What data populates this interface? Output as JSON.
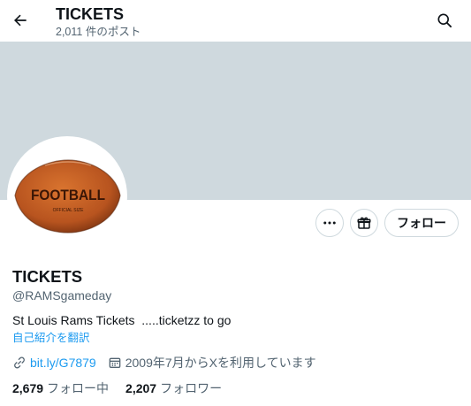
{
  "header": {
    "title": "TICKETS",
    "post_count": "2,011 件のポスト"
  },
  "avatar": {
    "text": "FOOTBALL",
    "subtext": "OFFICIAL SIZE"
  },
  "actions": {
    "follow_label": "フォロー"
  },
  "profile": {
    "name": "TICKETS",
    "handle": "@RAMSgameday",
    "bio": "St Louis Rams Tickets  .....ticketzz to go",
    "translate_label": "自己紹介を翻訳",
    "link": "bit.ly/G7879",
    "joined": "2009年7月からXを利用しています"
  },
  "stats": {
    "following_count": "2,679",
    "following_label": "フォロー中",
    "followers_count": "2,207",
    "followers_label": "フォロワー"
  },
  "colors": {
    "banner": "#cfd9de",
    "accent": "#1d9bf0",
    "secondary_text": "#536471",
    "football": "#b8541f"
  },
  "icons": {
    "back": "arrow-left-icon",
    "search": "search-icon",
    "more": "more-dots-icon",
    "subscribe": "gift-icon",
    "link": "link-icon",
    "calendar": "calendar-icon"
  }
}
